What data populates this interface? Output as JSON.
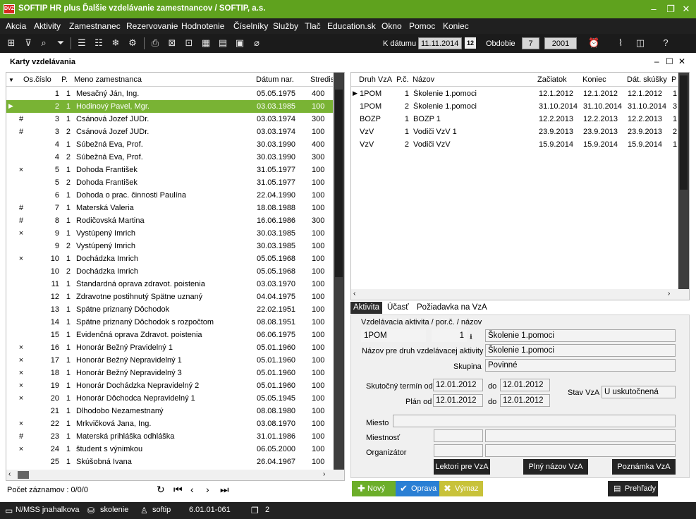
{
  "window": {
    "title": "SOFTIP HR plus Ďalšie vzdelávanie zamestnancov / SOFTIP, a.s.",
    "logo": "DVZ"
  },
  "menu": [
    "Akcia",
    "Aktivity",
    "Zamestnanec",
    "Rezervovanie",
    "Hodnotenie",
    "Číselníky",
    "Služby",
    "Tlač",
    "Education.sk",
    "Okno",
    "Pomoc",
    "Koniec"
  ],
  "toolbar": {
    "k_datumu_label": "K dátumu",
    "k_datumu_value": "11.11.2014",
    "obdobie_label": "Obdobie",
    "obdobie_month": "7",
    "obdobie_year": "2001",
    "calendar_day": "12"
  },
  "form_title": "Karty vzdelávania",
  "employees": {
    "columns": [
      "Os.číslo",
      "P.",
      "Meno zamestnanca",
      "Dátum nar.",
      "Stredis"
    ],
    "rows": [
      {
        "mark": "",
        "os": "1",
        "p": "1",
        "name": "Mesačný Ján, Ing.",
        "birth": "05.05.1975",
        "center": "400"
      },
      {
        "mark": "",
        "os": "2",
        "p": "1",
        "name": "Hodinový Pavel, Mgr.",
        "birth": "03.03.1985",
        "center": "100"
      },
      {
        "mark": "#",
        "os": "3",
        "p": "1",
        "name": "Csánová Jozef JUDr.",
        "birth": "03.03.1974",
        "center": "300"
      },
      {
        "mark": "#",
        "os": "3",
        "p": "2",
        "name": "Csánová Jozef JUDr.",
        "birth": "03.03.1974",
        "center": "100"
      },
      {
        "mark": "",
        "os": "4",
        "p": "1",
        "name": "Súbežná Eva, Prof.",
        "birth": "30.03.1990",
        "center": "400"
      },
      {
        "mark": "",
        "os": "4",
        "p": "2",
        "name": "Súbežná Eva, Prof.",
        "birth": "30.03.1990",
        "center": "300"
      },
      {
        "mark": "×",
        "os": "5",
        "p": "1",
        "name": "Dohoda František",
        "birth": "31.05.1977",
        "center": "100"
      },
      {
        "mark": "",
        "os": "5",
        "p": "2",
        "name": "Dohoda František",
        "birth": "31.05.1977",
        "center": "100"
      },
      {
        "mark": "",
        "os": "6",
        "p": "1",
        "name": "Dohoda o prac. činnosti Paulína",
        "birth": "22.04.1990",
        "center": "100"
      },
      {
        "mark": "#",
        "os": "7",
        "p": "1",
        "name": "Materská Valeria",
        "birth": "18.08.1988",
        "center": "100"
      },
      {
        "mark": "#",
        "os": "8",
        "p": "1",
        "name": "Rodičovská Martina",
        "birth": "16.06.1986",
        "center": "300"
      },
      {
        "mark": "×",
        "os": "9",
        "p": "1",
        "name": "Vystúpený Imrich",
        "birth": "30.03.1985",
        "center": "100"
      },
      {
        "mark": "",
        "os": "9",
        "p": "2",
        "name": "Vystúpený Imrich",
        "birth": "30.03.1985",
        "center": "100"
      },
      {
        "mark": "×",
        "os": "10",
        "p": "1",
        "name": "Dochádzka Imrich",
        "birth": "05.05.1968",
        "center": "100"
      },
      {
        "mark": "",
        "os": "10",
        "p": "2",
        "name": "Dochádzka Imrich",
        "birth": "05.05.1968",
        "center": "100"
      },
      {
        "mark": "",
        "os": "11",
        "p": "1",
        "name": "Štandardná oprava zdravot. poistenia",
        "birth": "03.03.1970",
        "center": "100"
      },
      {
        "mark": "",
        "os": "12",
        "p": "1",
        "name": "Zdravotne postihnutý Spätne uznaný",
        "birth": "04.04.1975",
        "center": "100"
      },
      {
        "mark": "",
        "os": "13",
        "p": "1",
        "name": "Spätne priznaný Dôchodok",
        "birth": "22.02.1951",
        "center": "100"
      },
      {
        "mark": "",
        "os": "14",
        "p": "1",
        "name": "Spätne priznaný Dôchodok s rozpočtom",
        "birth": "08.08.1951",
        "center": "100"
      },
      {
        "mark": "",
        "os": "15",
        "p": "1",
        "name": "Evidenčná oprava Zdravot. poistenia",
        "birth": "06.06.1975",
        "center": "100"
      },
      {
        "mark": "×",
        "os": "16",
        "p": "1",
        "name": "Honorár Bežný Pravidelný 1",
        "birth": "05.01.1960",
        "center": "100"
      },
      {
        "mark": "×",
        "os": "17",
        "p": "1",
        "name": "Honorár Bežný Nepravidelný 1",
        "birth": "05.01.1960",
        "center": "100"
      },
      {
        "mark": "×",
        "os": "18",
        "p": "1",
        "name": "Honorár Bežný Nepravidelný 3",
        "birth": "05.01.1960",
        "center": "100"
      },
      {
        "mark": "×",
        "os": "19",
        "p": "1",
        "name": "Honorár Dochádzka Nepravidelný 2",
        "birth": "05.01.1960",
        "center": "100"
      },
      {
        "mark": "×",
        "os": "20",
        "p": "1",
        "name": "Honorár Dôchodca Nepravidelný 1",
        "birth": "05.05.1945",
        "center": "100"
      },
      {
        "mark": "",
        "os": "21",
        "p": "1",
        "name": "Dlhodobo  Nezamestnaný",
        "birth": "08.08.1980",
        "center": "100"
      },
      {
        "mark": "×",
        "os": "22",
        "p": "1",
        "name": "Mrkvičková Jana, Ing.",
        "birth": "03.08.1970",
        "center": "100"
      },
      {
        "mark": "#",
        "os": "23",
        "p": "1",
        "name": "Materská  prihláška odhláška",
        "birth": "31.01.1986",
        "center": "100"
      },
      {
        "mark": "×",
        "os": "24",
        "p": "1",
        "name": "študent s výnimkou",
        "birth": "06.05.2000",
        "center": "100"
      },
      {
        "mark": "",
        "os": "25",
        "p": "1",
        "name": "Skúšobná Ivana",
        "birth": "26.04.1967",
        "center": "100"
      }
    ],
    "record_count": "Počet záznamov : 0/0/0"
  },
  "activities": {
    "columns": [
      "Druh VzA",
      "P.č.",
      "Názov",
      "Začiatok",
      "Koniec",
      "Dát. skúšky",
      "P"
    ],
    "rows": [
      {
        "druh": "1POM",
        "pc": "1",
        "nazov": "Školenie 1.pomoci",
        "start": "12.1.2012",
        "end": "12.1.2012",
        "exam": "12.1.2012",
        "p": "1"
      },
      {
        "druh": "1POM",
        "pc": "2",
        "nazov": "Školenie 1.pomoci",
        "start": "31.10.2014",
        "end": "31.10.2014",
        "exam": "31.10.2014",
        "p": "3"
      },
      {
        "druh": "BOZP",
        "pc": "1",
        "nazov": "BOZP 1",
        "start": "12.2.2013",
        "end": "12.2.2013",
        "exam": "12.2.2013",
        "p": "1"
      },
      {
        "druh": "VzV",
        "pc": "1",
        "nazov": "Vodiči VzV 1",
        "start": "23.9.2013",
        "end": "23.9.2013",
        "exam": "23.9.2013",
        "p": "2"
      },
      {
        "druh": "VzV",
        "pc": "2",
        "nazov": "Vodiči VzV",
        "start": "15.9.2014",
        "end": "15.9.2014",
        "exam": "15.9.2014",
        "p": "1"
      }
    ]
  },
  "tabs": [
    "Aktivita",
    "Účasť",
    "Požiadavka na VzA"
  ],
  "detail": {
    "activity_label": "Vzdelávacia aktivita / por.č. / názov",
    "activity_code": "1POM",
    "activity_no": "1",
    "activity_name": "Školenie 1.pomoci",
    "druh_name_label": "Názov pre druh vzdelávacej aktivity",
    "druh_name": "Školenie 1.pomoci",
    "group_label": "Skupina",
    "group": "Povinné",
    "actual_label": "Skutočný termín od",
    "actual_from": "12.01.2012",
    "do_label": "do",
    "actual_to": "12.01.2012",
    "plan_label": "Plán od",
    "plan_from": "12.01.2012",
    "plan_to": "12.01.2012",
    "status_label": "Stav VzA",
    "status": "U  uskutočnená",
    "place_label": "Miesto",
    "room_label": "Miestnosť",
    "organizer_label": "Organizátor",
    "btn_lectors": "Lektori pre VzA",
    "btn_fullname": "Plný názov VzA",
    "btn_note": "Poznámka VzA"
  },
  "actions": {
    "new": "Nový",
    "edit": "Oprava",
    "delete": "Výmaz",
    "overviews": "Prehľady"
  },
  "status": {
    "user": "N/MSS jnahalkova",
    "db": "skolenie",
    "app": "softip",
    "version": "6.01.01-061",
    "windows": "2"
  },
  "colors": {
    "title_green": "#5fa21e",
    "selected_row": "#79b334",
    "btn_new": "#6cae2a",
    "btn_edit": "#2a7fd4",
    "btn_delete": "#c8c23a"
  }
}
